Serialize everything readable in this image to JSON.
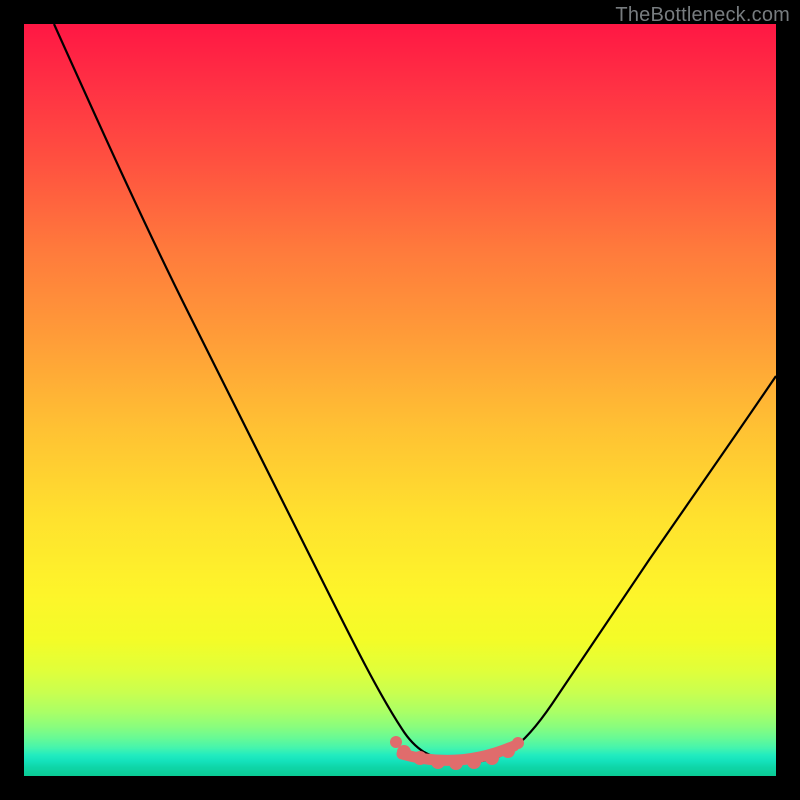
{
  "watermark": "TheBottleneck.com",
  "chart_data": {
    "type": "line",
    "title": "",
    "xlabel": "",
    "ylabel": "",
    "x_range": [
      0,
      100
    ],
    "y_range": [
      0,
      100
    ],
    "grid": false,
    "legend": false,
    "curve": {
      "name": "bottleneck-curve",
      "color": "#000000",
      "points": [
        {
          "x": 4,
          "y": 100
        },
        {
          "x": 10,
          "y": 86
        },
        {
          "x": 15,
          "y": 74
        },
        {
          "x": 20,
          "y": 63
        },
        {
          "x": 25,
          "y": 52
        },
        {
          "x": 30,
          "y": 42
        },
        {
          "x": 35,
          "y": 32
        },
        {
          "x": 40,
          "y": 22
        },
        {
          "x": 45,
          "y": 13
        },
        {
          "x": 48,
          "y": 7
        },
        {
          "x": 51,
          "y": 3.5
        },
        {
          "x": 55,
          "y": 1.8
        },
        {
          "x": 58,
          "y": 1.6
        },
        {
          "x": 62,
          "y": 1.8
        },
        {
          "x": 66,
          "y": 4
        },
        {
          "x": 70,
          "y": 9
        },
        {
          "x": 75,
          "y": 17
        },
        {
          "x": 80,
          "y": 25
        },
        {
          "x": 85,
          "y": 33
        },
        {
          "x": 90,
          "y": 41
        },
        {
          "x": 95,
          "y": 49
        },
        {
          "x": 100,
          "y": 57
        }
      ]
    },
    "highlight_band": {
      "name": "optimal-range",
      "color": "#e06c6c",
      "x_start": 50,
      "x_end": 65,
      "y_level": 2.5
    }
  }
}
